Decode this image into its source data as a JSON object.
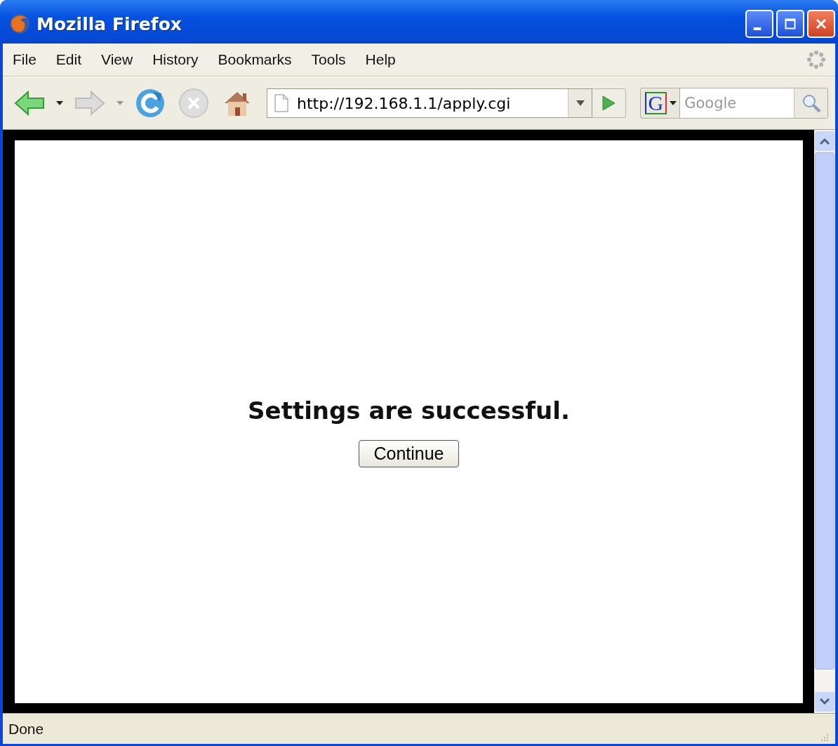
{
  "window": {
    "title": "Mozilla Firefox"
  },
  "menu": [
    {
      "label": "File"
    },
    {
      "label": "Edit"
    },
    {
      "label": "View"
    },
    {
      "label": "History"
    },
    {
      "label": "Bookmarks"
    },
    {
      "label": "Tools"
    },
    {
      "label": "Help"
    }
  ],
  "address_bar": {
    "value": "http://192.168.1.1/apply.cgi"
  },
  "search": {
    "placeholder": "Google",
    "engine_letter": "G"
  },
  "page": {
    "message": "Settings are successful.",
    "button": "Continue"
  },
  "status_bar": {
    "text": "Done"
  }
}
